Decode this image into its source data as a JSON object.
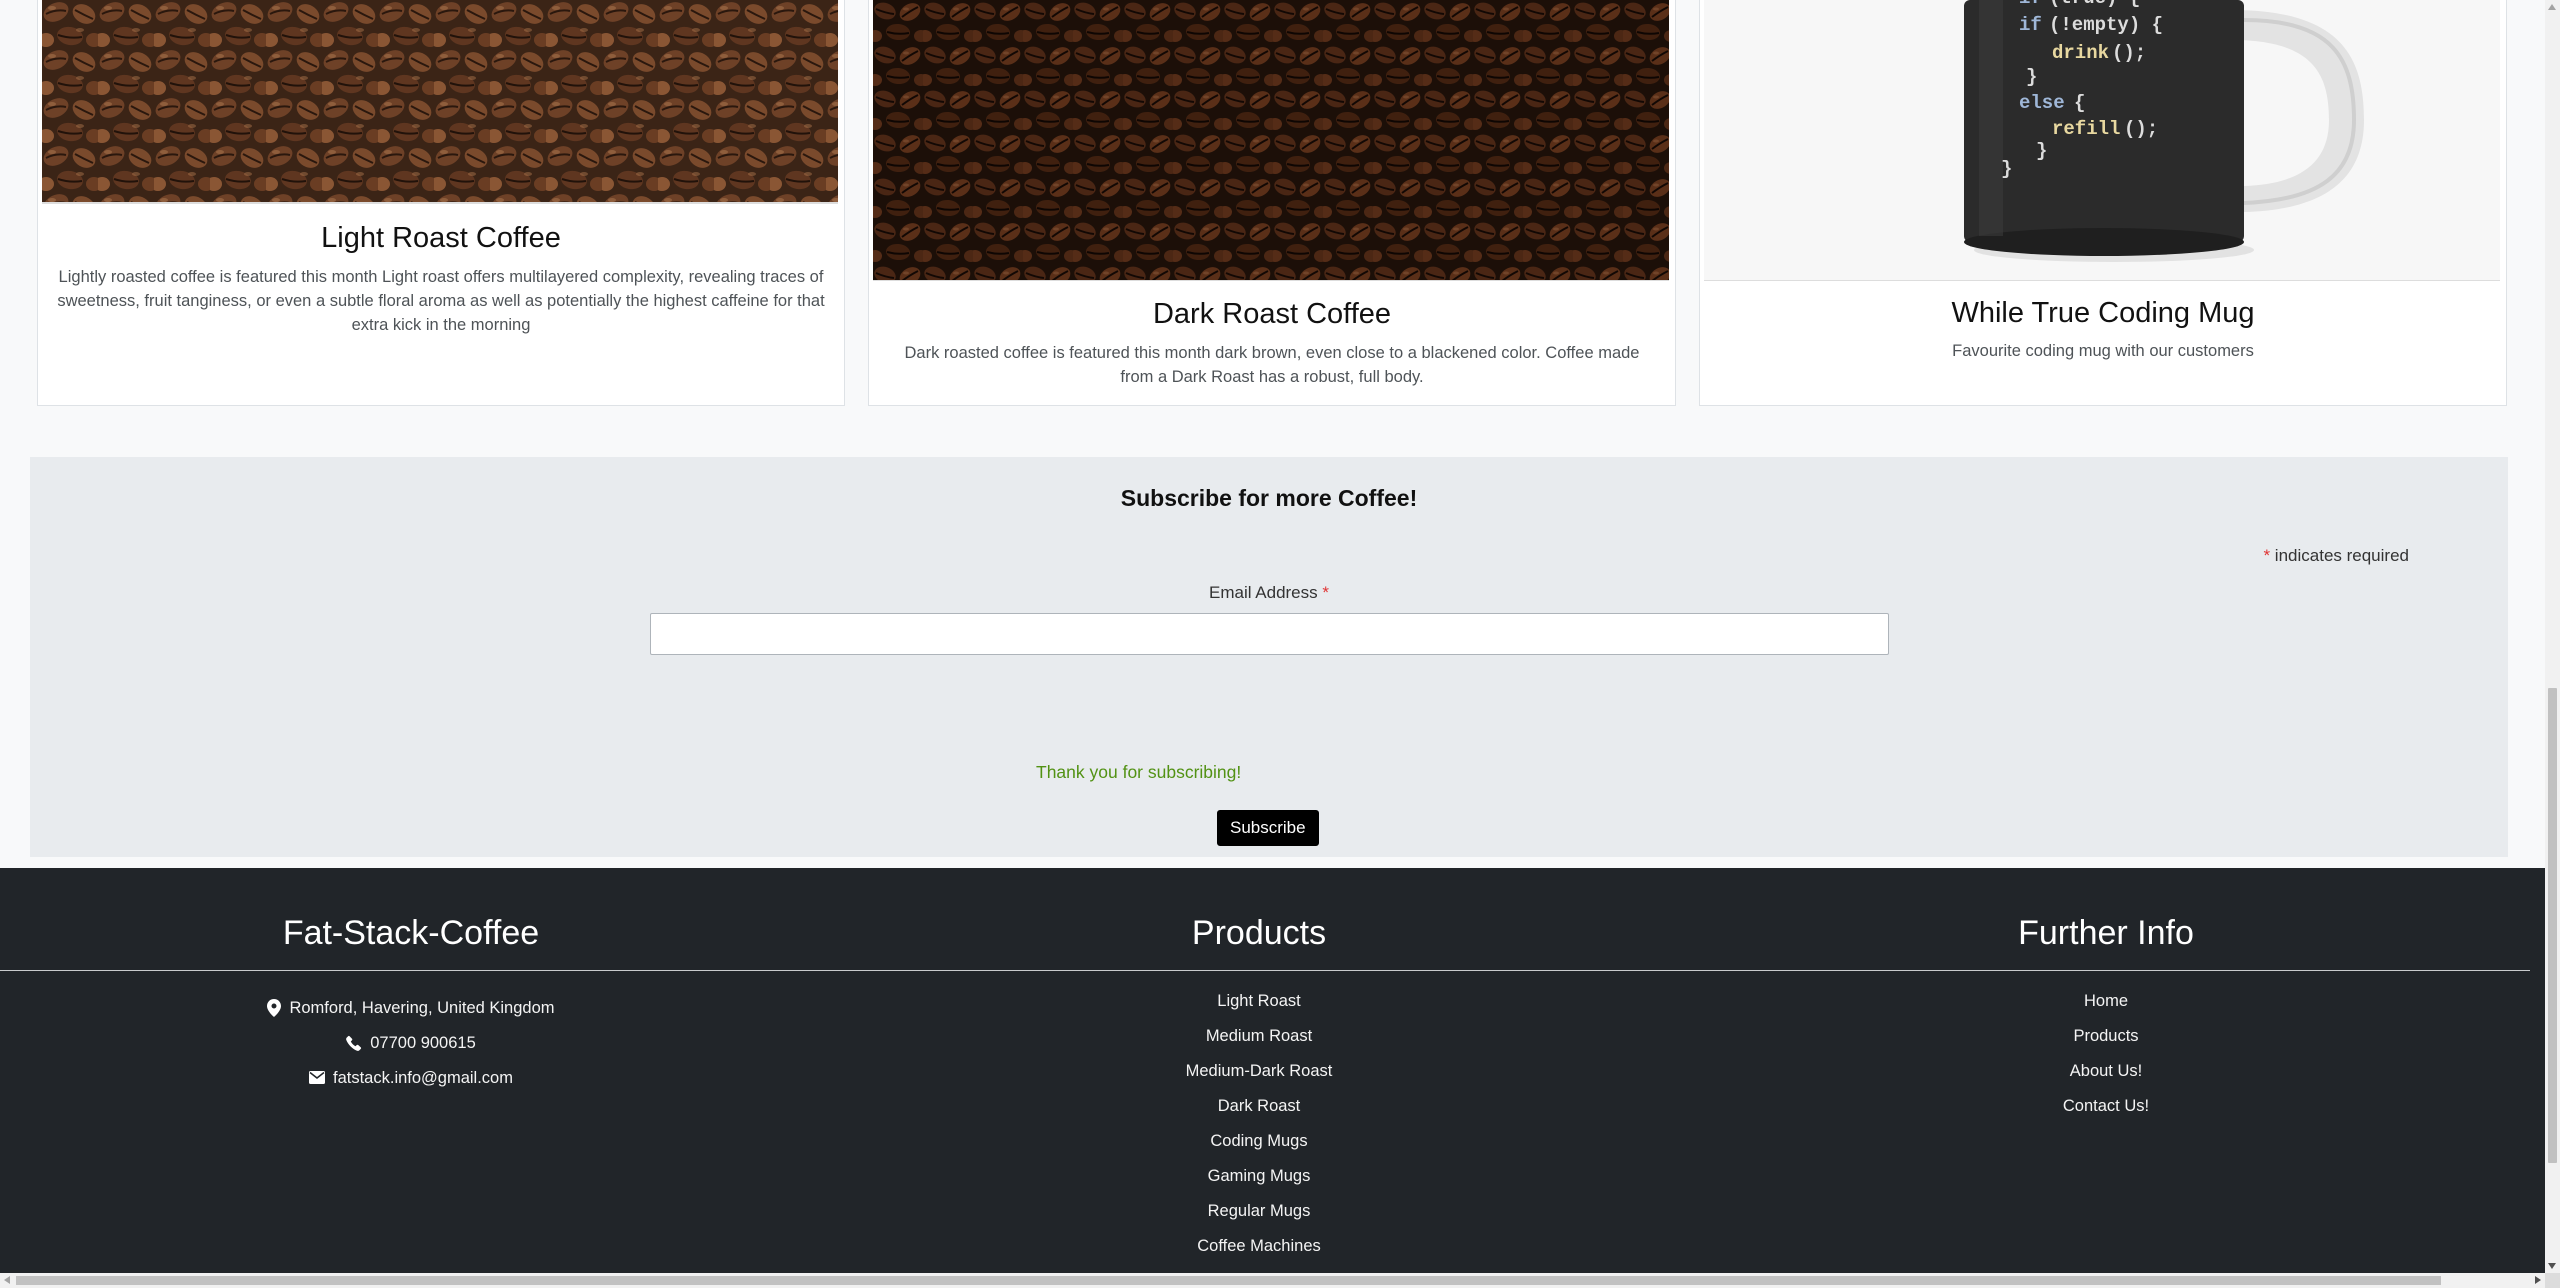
{
  "cards": [
    {
      "title": "Light Roast Coffee",
      "text": "Lightly roasted coffee is featured this month Light roast offers multilayered complexity, revealing traces of sweetness, fruit tanginess, or even a subtle floral aroma as well as potentially the highest caffeine for that extra kick in the morning",
      "image": "light-roast-coffee-beans"
    },
    {
      "title": "Dark Roast Coffee",
      "text": "Dark roasted coffee is featured this month dark brown, even close to a blackened color. Coffee made from a Dark Roast has a robust, full body.",
      "image": "dark-roast-coffee-beans"
    },
    {
      "title": "While True Coding Mug",
      "text": "Favourite coding mug with our customers",
      "image": "coding-mug",
      "mug_code": [
        "if (true) {",
        "if (!empty) {",
        "drink();",
        "}",
        "else {",
        "refill();",
        "}",
        "}"
      ]
    }
  ],
  "subscribe": {
    "title": "Subscribe for more Coffee!",
    "required_asterisk": "*",
    "required_note": "indicates required",
    "email_label": "Email Address",
    "email_asterisk": "*",
    "email_value": "",
    "thanks": "Thank you for subscribing!",
    "button": "Subscribe"
  },
  "footer": {
    "brand": {
      "heading": "Fat-Stack-Coffee",
      "location": "Romford, Havering, United Kingdom",
      "phone": "07700 900615",
      "email": "fatstack.info@gmail.com"
    },
    "products": {
      "heading": "Products",
      "items": [
        "Light Roast",
        "Medium Roast",
        "Medium-Dark Roast",
        "Dark Roast",
        "Coding Mugs",
        "Gaming Mugs",
        "Regular Mugs",
        "Coffee Machines"
      ]
    },
    "info": {
      "heading": "Further Info",
      "items": [
        "Home",
        "Products",
        "About Us!",
        "Contact Us!"
      ]
    }
  },
  "colors": {
    "footer_bg": "#212529",
    "subscribe_bg": "#e8ebee",
    "success_text": "#529214",
    "required_asterisk": "#e03333",
    "button_bg": "#000000"
  }
}
